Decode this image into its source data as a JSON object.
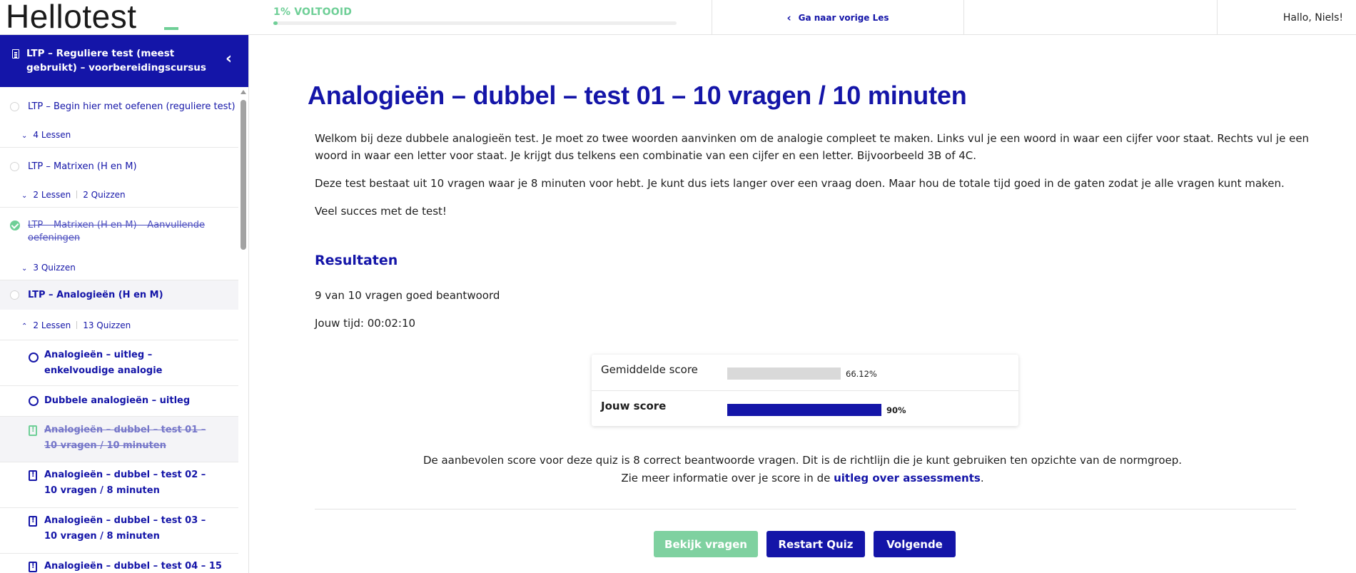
{
  "header": {
    "logo_text": "Hellotest",
    "progress_label": "1% VOLTOOID",
    "progress_fraction": 0.01,
    "prev_lesson_label": "Ga naar vorige Les",
    "greeting": "Hallo, Niels!"
  },
  "sidebar": {
    "course_title": "LTP – Reguliere test (meest gebruikt) – voorbereidingscursus",
    "sections": [
      {
        "title": "LTP – Begin hier met oefenen (reguliere test)",
        "meta_lessons": "4 Lessen",
        "meta_quizzes": ""
      },
      {
        "title": "LTP – Matrixen (H en M)",
        "meta_lessons": "2 Lessen",
        "meta_quizzes": "2 Quizzen"
      },
      {
        "title": "LTP – Matrixen (H en M) – Aanvullende oefeningen",
        "meta_lessons": "",
        "meta_quizzes": "3 Quizzen"
      },
      {
        "title": "LTP – Analogieën (H en M)",
        "meta_lessons": "2 Lessen",
        "meta_quizzes": "13 Quizzen"
      }
    ],
    "lessons": [
      {
        "title": "Analogieën – uitleg – enkelvoudige analogie"
      },
      {
        "title": "Dubbele analogieën – uitleg"
      },
      {
        "title": "Analogieën – dubbel – test 01 – 10 vragen / 10 minuten"
      },
      {
        "title": "Analogieën – dubbel – test 02 – 10 vragen / 8 minuten"
      },
      {
        "title": "Analogieën – dubbel – test 03 – 10 vragen / 8 minuten"
      },
      {
        "title": "Analogieën – dubbel – test 04 – 15"
      }
    ]
  },
  "main": {
    "title": "Analogieën – dubbel – test 01 – 10 vragen / 10 minuten",
    "intro_1": "Welkom bij deze dubbele analogieën test. Je moet zo twee woorden aanvinken om de analogie compleet te maken. Links vul je een woord in waar een cijfer voor staat. Rechts vul je een woord in waar een letter voor staat. Je krijgt dus telkens een combinatie van een cijfer en een letter. Bijvoorbeeld 3B of 4C.",
    "intro_2": "Deze test bestaat uit 10 vragen waar je 8 minuten voor hebt. Je kunt dus iets langer over een vraag doen. Maar hou de totale tijd goed in de gaten zodat je alle vragen kunt maken.",
    "intro_3": "Veel succes met de test!",
    "results_heading": "Resultaten",
    "correct_summary": "9 van 10 vragen goed beantwoord",
    "time_summary": "Jouw tijd: 00:02:10",
    "scores": [
      {
        "label": "Gemiddelde score",
        "value": 66.12,
        "display": "66.12%",
        "color": "#d9d9d9"
      },
      {
        "label": "Jouw score",
        "value": 90,
        "display": "90%",
        "color": "#1415a8"
      }
    ],
    "recommend_line_1": "De aanbevolen score voor deze quiz is 8 correct beantwoorde vragen. Dit is de richtlijn die je kunt gebruiken ten opzichte van de normgroep.",
    "recommend_line_2_prefix": "Zie meer informatie over je score in de ",
    "recommend_link": "uitleg over assessments",
    "recommend_line_2_suffix": ".",
    "buttons": {
      "review": "Bekijk vragen",
      "restart": "Restart Quiz",
      "next": "Volgende"
    }
  },
  "colors": {
    "brand": "#1415a8",
    "accent_green": "#6fcf97"
  }
}
